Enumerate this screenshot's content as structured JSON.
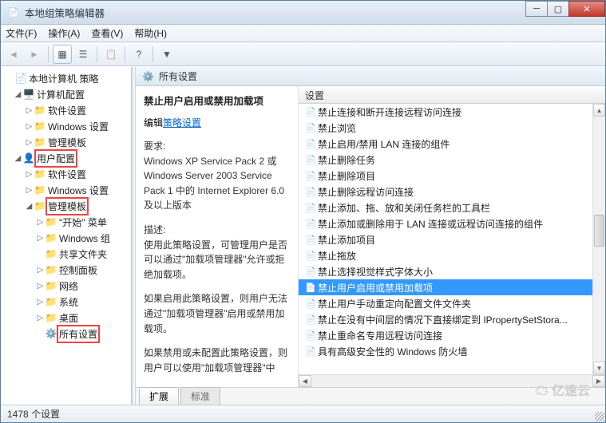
{
  "window": {
    "title": "本地组策略编辑器"
  },
  "menubar": [
    "文件(F)",
    "操作(A)",
    "查看(V)",
    "帮助(H)"
  ],
  "tree": {
    "root": "本地计算机 策略",
    "computer_config": "计算机配置",
    "software1": "软件设置",
    "windows1": "Windows 设置",
    "admin1": "管理模板",
    "user_config": "用户配置",
    "software2": "软件设置",
    "windows2": "Windows 设置",
    "admin2": "管理模板",
    "start_menu": "\"开始\" 菜单",
    "windows_comp": "Windows 组",
    "shared": "共享文件夹",
    "ctrlpanel": "控制面板",
    "network": "网络",
    "system": "系统",
    "desktop": "桌面",
    "allsettings": "所有设置"
  },
  "content": {
    "header": "所有设置",
    "title": "禁止用户启用或禁用加载项",
    "edit_link_prefix": "编辑",
    "edit_link": "策略设置",
    "req_label": "要求:",
    "req_text": "Windows XP Service Pack 2 或 Windows Server 2003 Service Pack 1 中的 Internet Explorer 6.0 及以上版本",
    "desc_label": "描述:",
    "desc1": "使用此策略设置，可管理用户是否可以通过\"加载项管理器\"允许或拒绝加载项。",
    "desc2": "如果启用此策略设置，则用户无法通过\"加载项管理器\"启用或禁用加载项。",
    "desc3": "如果禁用或未配置此策略设置，则用户可以使用\"加载项管理器\"中"
  },
  "list": {
    "header": "设置",
    "items": [
      "禁止连接和断开连接远程访问连接",
      "禁止浏览",
      "禁止启用/禁用 LAN 连接的组件",
      "禁止删除任务",
      "禁止删除项目",
      "禁止删除远程访问连接",
      "禁止添加、拖、放和关闭任务栏的工具栏",
      "禁止添加或删除用于 LAN 连接或远程访问连接的组件",
      "禁止添加项目",
      "禁止拖放",
      "禁止选择视觉样式字体大小",
      "禁止用户启用或禁用加载项",
      "禁止用户手动重定向配置文件文件夹",
      "禁止在没有中间层的情况下直接绑定到 IPropertySetStora...",
      "禁止重命名专用远程访问连接",
      "具有高级安全性的 Windows 防火墙"
    ],
    "selected_index": 11
  },
  "tabs": {
    "left": "扩展",
    "right": "标准"
  },
  "statusbar": "1478 个设置",
  "watermark": "亿速云"
}
